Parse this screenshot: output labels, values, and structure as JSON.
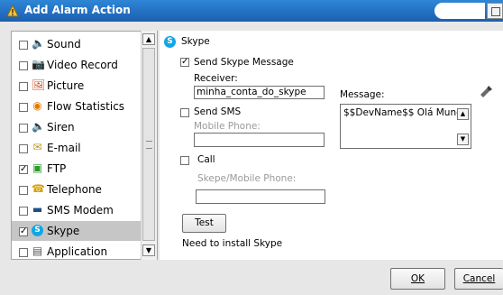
{
  "window": {
    "title": "Add Alarm Action"
  },
  "actions": [
    {
      "label": "Sound",
      "checked": false,
      "icon": "speaker-icon",
      "glyph": "🔈"
    },
    {
      "label": "Video Record",
      "checked": false,
      "icon": "camera-icon",
      "glyph": "📷"
    },
    {
      "label": "Picture",
      "checked": false,
      "icon": "picture-icon",
      "glyph": "🖼"
    },
    {
      "label": "Flow Statistics",
      "checked": false,
      "icon": "flow-statistics-icon",
      "glyph": "◉"
    },
    {
      "label": "Siren",
      "checked": false,
      "icon": "siren-icon",
      "glyph": "🔈"
    },
    {
      "label": "E-mail",
      "checked": false,
      "icon": "envelope-icon",
      "glyph": "✉"
    },
    {
      "label": "FTP",
      "checked": true,
      "icon": "ftp-icon",
      "glyph": "▣"
    },
    {
      "label": "Telephone",
      "checked": false,
      "icon": "telephone-icon",
      "glyph": "☎"
    },
    {
      "label": "SMS Modem",
      "checked": false,
      "icon": "modem-icon",
      "glyph": "▬"
    },
    {
      "label": "Skype",
      "checked": true,
      "selected": true,
      "icon": "skype-icon",
      "glyph": "S"
    },
    {
      "label": "Application",
      "checked": false,
      "icon": "application-icon",
      "glyph": "▤"
    }
  ],
  "skype": {
    "header": "Skype",
    "send_message_label": "Send Skype Message",
    "send_message_checked": true,
    "receiver_label": "Receiver:",
    "receiver_value": "minha_conta_do_skype",
    "message_label": "Message:",
    "message_value": "$$DevName$$ Olá Mundo",
    "send_sms_label": "Send SMS",
    "send_sms_checked": false,
    "mobile_phone_label": "Mobile Phone:",
    "mobile_phone_value": "",
    "call_label": "Call",
    "call_checked": false,
    "skype_mobile_label": "Skepe/Mobile Phone:",
    "skype_mobile_value": "",
    "test_button": "Test",
    "note": "Need to install Skype"
  },
  "buttons": {
    "ok": "OK",
    "cancel": "Cancel"
  },
  "colors": {
    "titlebar": "#1b5fb0",
    "selection": "#c6c6c6",
    "skype": "#11a7e6"
  }
}
